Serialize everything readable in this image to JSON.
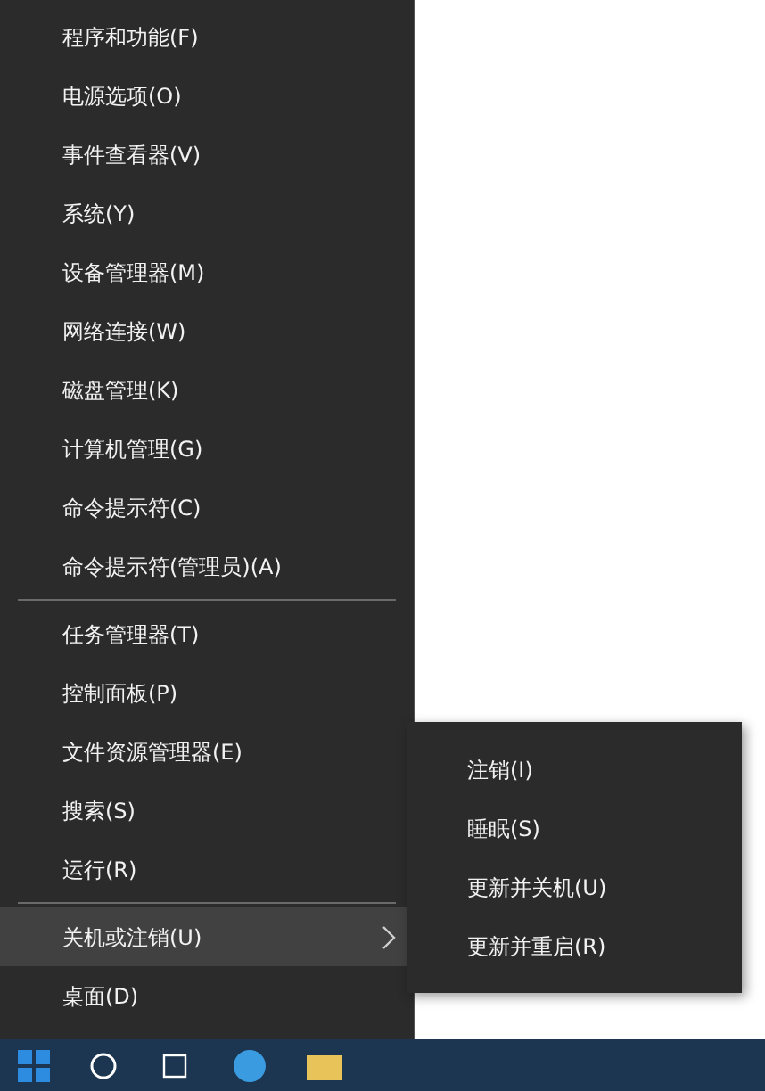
{
  "menu": {
    "groups": [
      {
        "items": [
          {
            "label": "程序和功能(F)",
            "selected": false,
            "submenu": false
          },
          {
            "label": "电源选项(O)",
            "selected": false,
            "submenu": false
          },
          {
            "label": "事件查看器(V)",
            "selected": false,
            "submenu": false
          },
          {
            "label": "系统(Y)",
            "selected": false,
            "submenu": false
          },
          {
            "label": "设备管理器(M)",
            "selected": false,
            "submenu": false
          },
          {
            "label": "网络连接(W)",
            "selected": false,
            "submenu": false
          },
          {
            "label": "磁盘管理(K)",
            "selected": false,
            "submenu": false
          },
          {
            "label": "计算机管理(G)",
            "selected": false,
            "submenu": false
          },
          {
            "label": "命令提示符(C)",
            "selected": false,
            "submenu": false
          },
          {
            "label": "命令提示符(管理员)(A)",
            "selected": false,
            "submenu": false
          }
        ]
      },
      {
        "items": [
          {
            "label": "任务管理器(T)",
            "selected": false,
            "submenu": false
          },
          {
            "label": "控制面板(P)",
            "selected": false,
            "submenu": false
          },
          {
            "label": "文件资源管理器(E)",
            "selected": false,
            "submenu": false
          },
          {
            "label": "搜索(S)",
            "selected": false,
            "submenu": false
          },
          {
            "label": "运行(R)",
            "selected": false,
            "submenu": false
          }
        ]
      },
      {
        "items": [
          {
            "label": "关机或注销(U)",
            "selected": true,
            "submenu": true
          },
          {
            "label": "桌面(D)",
            "selected": false,
            "submenu": false
          }
        ]
      }
    ]
  },
  "submenu": {
    "items": [
      {
        "label": "注销(I)"
      },
      {
        "label": "睡眠(S)"
      },
      {
        "label": "更新并关机(U)"
      },
      {
        "label": "更新并重启(R)"
      }
    ]
  }
}
